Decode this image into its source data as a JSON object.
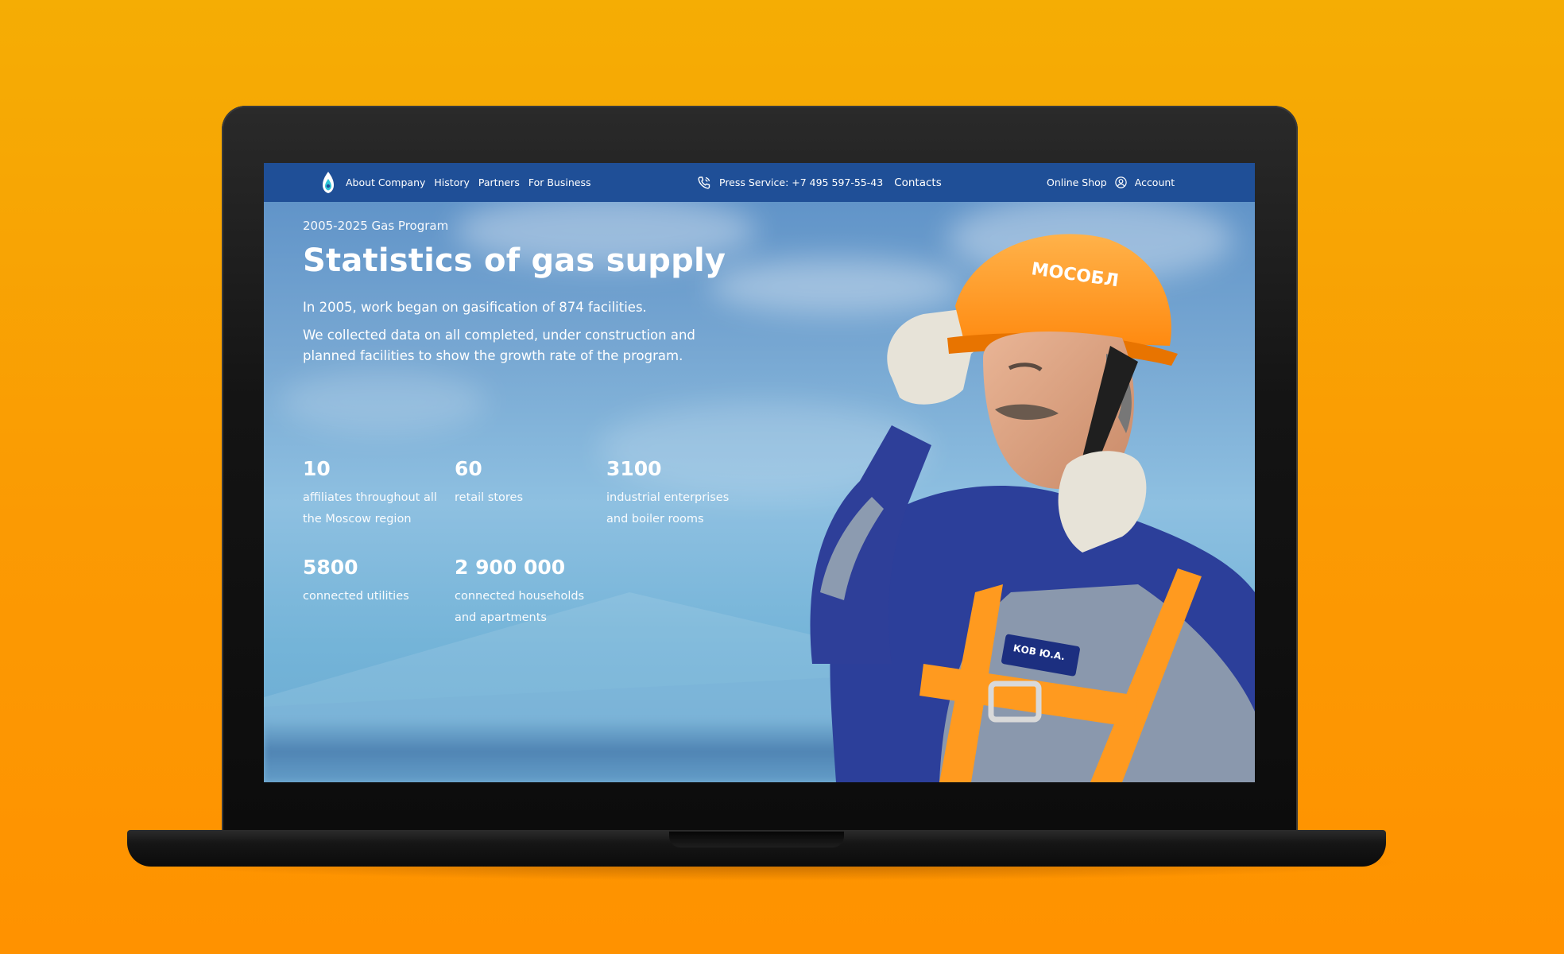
{
  "nav": {
    "about": "About Company",
    "history": "History",
    "partners": "Partners",
    "business": "For Business",
    "press": "Press Service: +7 495 597-55-43",
    "contacts": "Contacts",
    "shop": "Online Shop",
    "account": "Account"
  },
  "hero": {
    "eyebrow": "2005-2025 Gas Program",
    "title": "Statistics of gas supply",
    "lead": "In 2005, work began on gasification of 874 facilities.",
    "desc": "We collected data on all completed, under construction and planned facilities to show the growth rate of the program."
  },
  "stats": [
    {
      "value": "10",
      "label": "affiliates throughout all the Moscow region"
    },
    {
      "value": "60",
      "label": "retail stores"
    },
    {
      "value": "3100",
      "label": "industrial enterprises and boiler rooms"
    },
    {
      "value": "5800",
      "label": "connected utilities"
    },
    {
      "value": "2 900 000",
      "label": "connected households and apartments"
    }
  ],
  "worker": {
    "helmet_text": "МОСОБЛ",
    "badge_text": "КОВ Ю.А."
  },
  "colors": {
    "background": "#fa9f03",
    "nav": "#1f4f97",
    "helmet": "#ff9a1f",
    "uniform": "#2c3f9a"
  },
  "icons": [
    "logo-icon",
    "phone-icon",
    "user-icon"
  ]
}
